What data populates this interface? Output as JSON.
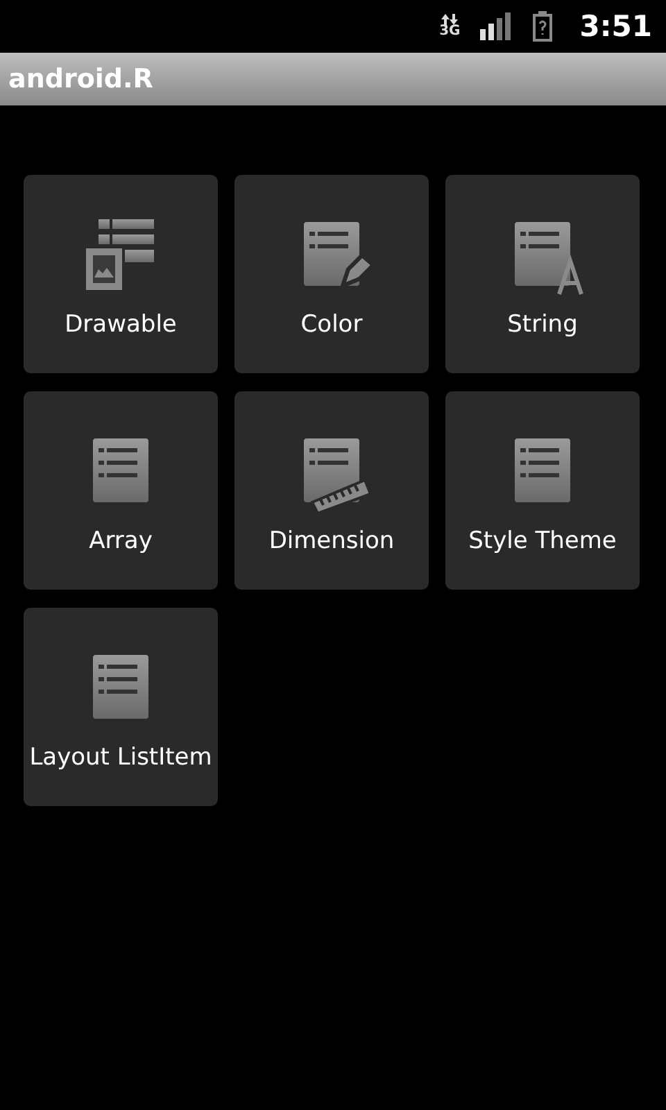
{
  "status_bar": {
    "network": "3G",
    "time": "3:51"
  },
  "title_bar": {
    "title": "android.R"
  },
  "tiles": [
    {
      "label": "Drawable",
      "kind": "drawable"
    },
    {
      "label": "Color",
      "kind": "color"
    },
    {
      "label": "String",
      "kind": "string"
    },
    {
      "label": "Array",
      "kind": "list"
    },
    {
      "label": "Dimension",
      "kind": "dimension"
    },
    {
      "label": "Style Theme",
      "kind": "list"
    },
    {
      "label": "Layout ListItem",
      "kind": "list"
    }
  ]
}
